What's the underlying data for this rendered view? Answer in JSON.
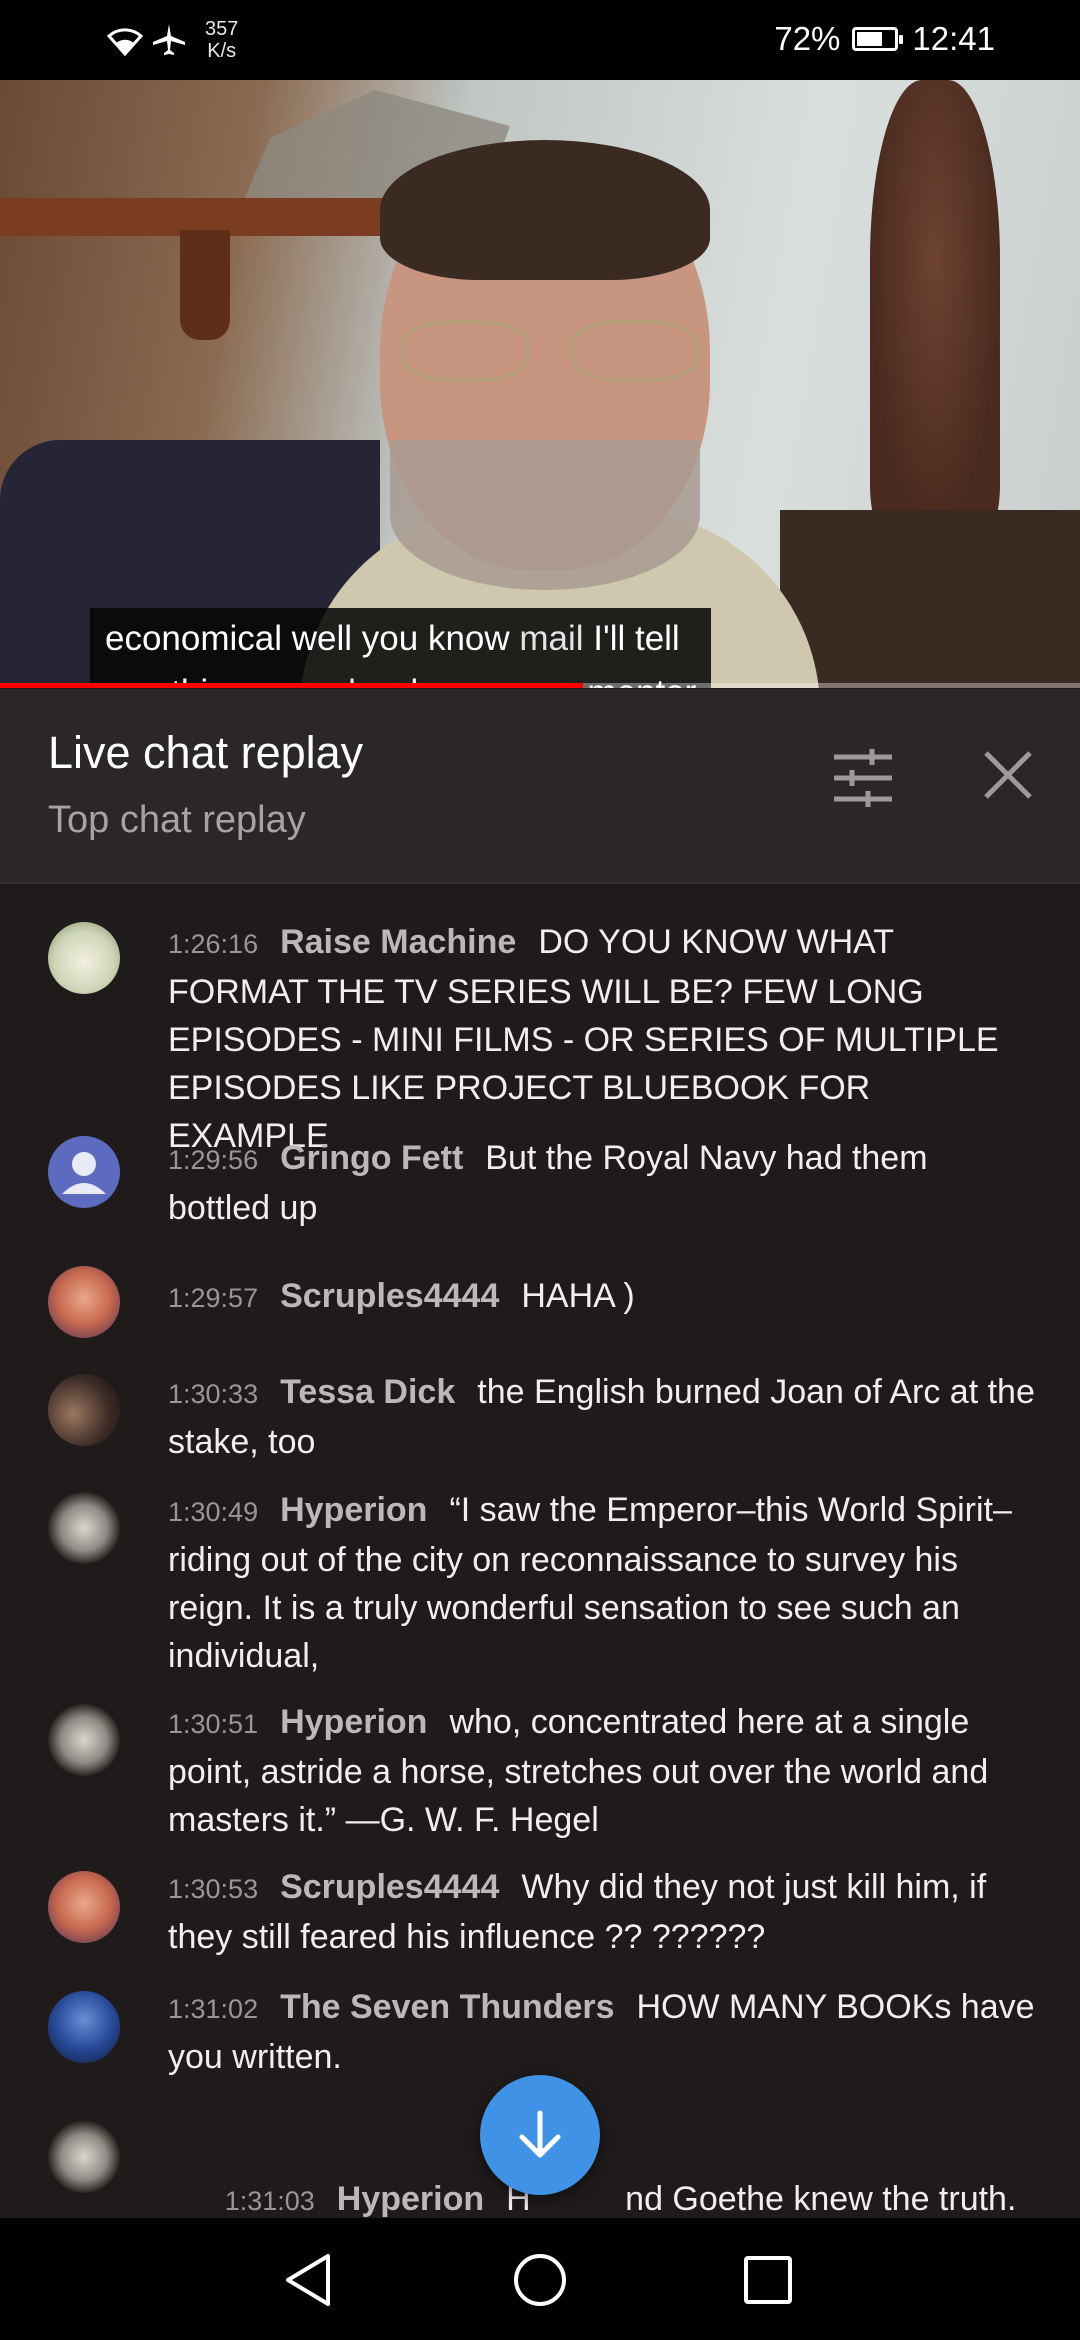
{
  "status_bar": {
    "net_speed_value": "357",
    "net_speed_unit": "K/s",
    "battery_percent": "72%",
    "battery_level": 0.72,
    "time": "12:41"
  },
  "video": {
    "caption_line1_parts": [
      "economical",
      " well you know ",
      "mail",
      " I'll tell"
    ],
    "caption_line2_parts": [
      "you this my ",
      "uncle",
      " who was ",
      "my",
      " mentor"
    ],
    "progress": 0.54
  },
  "chat_header": {
    "title": "Live chat replay",
    "subtitle": "Top chat replay"
  },
  "messages": [
    {
      "time": "1:26:16",
      "author": "Raise Machine",
      "text": "DO YOU KNOW WHAT FORMAT THE TV SERIES WILL BE? FEW LONG EPISODES - MINI FILMS - OR SERIES OF MULTIPLE EPISODES LIKE PROJECT BLUEBOOK FOR EXAMPLE",
      "avatar": "raise-machine-avatar"
    },
    {
      "time": "1:29:56",
      "author": "Gringo Fett",
      "text": "But the Royal Navy had them bottled up",
      "avatar": "default-user-avatar"
    },
    {
      "time": "1:29:57",
      "author": "Scruples4444",
      "text": "HAHA )",
      "avatar": "scruples-avatar"
    },
    {
      "time": "1:30:33",
      "author": "Tessa Dick",
      "text": "the English burned Joan of Arc at the stake, too",
      "avatar": "tessa-dick-avatar"
    },
    {
      "time": "1:30:49",
      "author": "Hyperion",
      "text": "“I saw the Emperor–this World Spirit–riding out of the city on reconnaissance to survey his reign. It is a truly wonderful sensation to see such an individual,",
      "avatar": "hyperion-avatar"
    },
    {
      "time": "1:30:51",
      "author": "Hyperion",
      "text": "who, concentrated here at a single point, astride a horse, stretches out over the world and masters it.” —G. W. F. Hegel",
      "avatar": "hyperion-avatar"
    },
    {
      "time": "1:30:53",
      "author": "Scruples4444",
      "text": "Why did they not just kill him, if they still feared his influence ?? ??????",
      "avatar": "scruples-avatar"
    },
    {
      "time": "1:31:02",
      "author": "The Seven Thunders",
      "text": "HOW MANY BOOKs have you written.",
      "avatar": "seven-thunders-avatar"
    },
    {
      "time": "1:31:03",
      "author": "Hyperion",
      "text": "H          nd Goethe knew the truth.",
      "avatar": "hyperion-avatar"
    }
  ]
}
